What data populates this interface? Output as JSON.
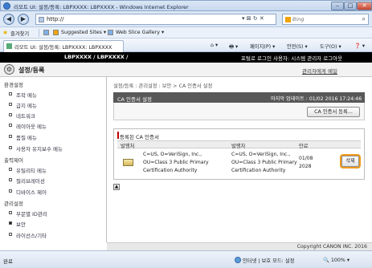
{
  "window": {
    "title": "리모트 UI: 설정/등록: LBPXXXX: LBPXXXX - Windows Internet Explorer",
    "minimize": "–",
    "maximize": "□",
    "close": "✕"
  },
  "addressbar": {
    "url": "http://",
    "back": "◀",
    "forward": "▶",
    "buttons": "▾ ⊠ ↻ ✕",
    "search_placeholder": "Bing",
    "search_icon": "⌕"
  },
  "favorites": {
    "label": "즐겨찾기",
    "items": [
      "Suggested Sites ▾",
      "Web Slice Gallery ▾"
    ]
  },
  "tabbar": {
    "tab_label": "리모트 UI: 설정/등록: LBPXXXX: LBPXXXX",
    "commands": [
      "페이지(P) ▾",
      "안전(S) ▾",
      "도구(O) ▾",
      "❓ ▾"
    ]
  },
  "canon_header": {
    "model": "LBPXXXX / LBPXXXX /",
    "login_info": "포털로  로그인 사용자: 시스템 관리자 로그아웃"
  },
  "subheader": {
    "title": "설정/등록",
    "mail_link": "관리자에게 메일"
  },
  "sidebar": {
    "sections": [
      {
        "heading": "환경설정",
        "items": [
          "조작 메뉴",
          "급지 메뉴",
          "네트워크",
          "레이아웃 메뉴",
          "품질 메뉴",
          "사용자 유지보수 메뉴"
        ]
      },
      {
        "heading": "출력제어",
        "items": [
          "유틸리티 메뉴",
          "절리브레이션",
          "디바이스 제어"
        ]
      },
      {
        "heading": "관리설정",
        "items": [
          "부문별 ID관리",
          "보안",
          "라이선스/기타"
        ]
      }
    ]
  },
  "main": {
    "breadcrumb": "설정/등록 : 관리설정 : 보안 > CA 인증서 설정",
    "panel_title": "CA 인증서 설정",
    "last_update": "마지막 업데이트 : 01/02 2016 17:24:46",
    "register_button": "CA 인증서 등록...",
    "list_title": "등록된 CA 인증서",
    "columns": [
      "발행처",
      "발행자",
      "만료"
    ],
    "rows": [
      {
        "issued_to": [
          "C=US, O=VeriSign, Inc.,",
          "OU=Class 3 Public Primary",
          "Certification Authority"
        ],
        "issuer": [
          "C=US, O=VeriSign, Inc.,",
          "OU=Class 3 Public Primary",
          "Certification Authority"
        ],
        "expiry": [
          "01/08",
          "2028"
        ],
        "delete_button": "삭제"
      }
    ],
    "top_icon": "▲",
    "copyright": "Copyright CANON INC. 2016"
  },
  "statusbar": {
    "status": "완료",
    "zone": "인터넷 | 보호 모드: 설정",
    "zoom": "🔍 100% ▾"
  },
  "colors": {
    "header_black": "#000000",
    "panel_gray": "#585858",
    "accent_orange": "#f29a1a",
    "accent_red": "#c00000"
  }
}
